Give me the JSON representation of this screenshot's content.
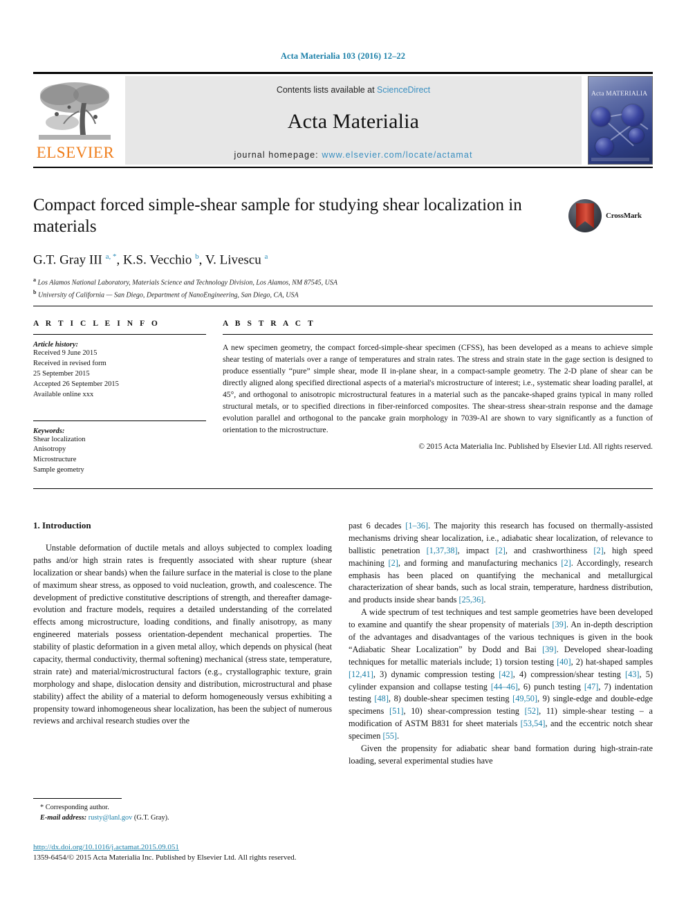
{
  "running_head": "Acta Materialia 103 (2016) 12–22",
  "masthead": {
    "contents_prefix": "Contents lists available at ",
    "sciencedirect": "ScienceDirect",
    "journal_name": "Acta Materialia",
    "homepage_prefix": "journal homepage: ",
    "homepage_url": "www.elsevier.com/locate/actamat",
    "publisher": "ELSEVIER",
    "cover_title": "Acta MATERIALIA",
    "link_color": "#3a8fc0",
    "accent_color": "#1a7fa8",
    "elsevier_orange": "#ef7d1a"
  },
  "article": {
    "title": "Compact forced simple-shear sample for studying shear localization in materials",
    "crossmark_label": "CrossMark",
    "authors_html": "G.T. Gray III <sup>a, *</sup>, K.S. Vecchio <sup>b</sup>, V. Livescu <sup>a</sup>",
    "affiliations": [
      {
        "marker": "a",
        "text": "Los Alamos National Laboratory, Materials Science and Technology Division, Los Alamos, NM 87545, USA"
      },
      {
        "marker": "b",
        "text": "University of California — San Diego, Department of NanoEngineering, San Diego, CA, USA"
      }
    ]
  },
  "article_info": {
    "label": "A R T I C L E   I N F O",
    "history_heading": "Article history:",
    "history": [
      "Received 9 June 2015",
      "Received in revised form",
      "25 September 2015",
      "Accepted 26 September 2015",
      "Available online xxx"
    ],
    "keywords_heading": "Keywords:",
    "keywords": [
      "Shear localization",
      "Anisotropy",
      "Microstructure",
      "Sample geometry"
    ]
  },
  "abstract": {
    "label": "A B S T R A C T",
    "text": "A new specimen geometry, the compact forced-simple-shear specimen (CFSS), has been developed as a means to achieve simple shear testing of materials over a range of temperatures and strain rates. The stress and strain state in the gage section is designed to produce essentially “pure” simple shear, mode II in-plane shear, in a compact-sample geometry. The 2-D plane of shear can be directly aligned along specified directional aspects of a material's microstructure of interest; i.e., systematic shear loading parallel, at 45°, and orthogonal to anisotropic microstructural features in a material such as the pancake-shaped grains typical in many rolled structural metals, or to specified directions in fiber-reinforced composites. The shear-stress shear-strain response and the damage evolution parallel and orthogonal to the pancake grain morphology in 7039-Al are shown to vary significantly as a function of orientation to the microstructure.",
    "copyright": "© 2015 Acta Materialia Inc. Published by Elsevier Ltd. All rights reserved."
  },
  "introduction": {
    "heading": "1. Introduction",
    "left_paragraph": "Unstable deformation of ductile metals and alloys subjected to complex loading paths and/or high strain rates is frequently associated with shear rupture (shear localization or shear bands) when the failure surface in the material is close to the plane of maximum shear stress, as opposed to void nucleation, growth, and coalescence. The development of predictive constitutive descriptions of strength, and thereafter damage-evolution and fracture models, requires a detailed understanding of the correlated effects among microstructure, loading conditions, and finally anisotropy, as many engineered materials possess orientation-dependent mechanical properties. The stability of plastic deformation in a given metal alloy, which depends on physical (heat capacity, thermal conductivity, thermal softening) mechanical (stress state, temperature, strain rate) and material/microstructural factors (e.g., crystallographic texture, grain morphology and shape, dislocation density and distribution, microstructural and phase stability) affect the ability of a material to deform homogeneously versus exhibiting a propensity toward inhomogeneous shear localization, has been the subject of numerous reviews and archival research studies over the",
    "right_paragraph_1_html": "past 6 decades <span class=\"ref\">[1&ndash;36]</span>. The majority this research has focused on thermally-assisted mechanisms driving shear localization, i.e., adiabatic shear localization, of relevance to ballistic penetration <span class=\"ref\">[1,37,38]</span>, impact <span class=\"ref\">[2]</span>, and crashworthiness <span class=\"ref\">[2]</span>, high speed machining <span class=\"ref\">[2]</span>, and forming and manufacturing mechanics <span class=\"ref\">[2]</span>. Accordingly, research emphasis has been placed on quantifying the mechanical and metallurgical characterization of shear bands, such as local strain, temperature, hardness distribution, and products inside shear bands <span class=\"ref\">[25,36]</span>.",
    "right_paragraph_2_html": "A wide spectrum of test techniques and test sample geometries have been developed to examine and quantify the shear propensity of materials <span class=\"ref\">[39]</span>. An in-depth description of the advantages and disadvantages of the various techniques is given in the book &ldquo;Adiabatic Shear Localization&rdquo; by Dodd and Bai <span class=\"ref\">[39]</span>. Developed shear-loading techniques for metallic materials include; 1) torsion testing <span class=\"ref\">[40]</span>, 2) hat-shaped samples <span class=\"ref\">[12,41]</span>, 3) dynamic compression testing <span class=\"ref\">[42]</span>, 4) compression/shear testing <span class=\"ref\">[43]</span>, 5) cylinder expansion and collapse testing <span class=\"ref\">[44&ndash;46]</span>, 6) punch testing <span class=\"ref\">[47]</span>, 7) indentation testing <span class=\"ref\">[48]</span>, 8) double-shear specimen testing <span class=\"ref\">[49,50]</span>, 9) single-edge and double-edge specimens <span class=\"ref\">[51]</span>, 10) shear-compression testing <span class=\"ref\">[52]</span>, 11) simple-shear testing &ndash; a modification of ASTM B831 for sheet materials <span class=\"ref\">[53,54]</span>, and the eccentric notch shear specimen <span class=\"ref\">[55]</span>.",
    "right_paragraph_3": "Given the propensity for adiabatic shear band formation during high-strain-rate loading, several experimental studies have"
  },
  "footer": {
    "corresponding_author": "* Corresponding author.",
    "email_label": "E-mail address:",
    "email": "rusty@lanl.gov",
    "email_suffix": "(G.T. Gray).",
    "doi": "http://dx.doi.org/10.1016/j.actamat.2015.09.051",
    "issn_line": "1359-6454/© 2015 Acta Materialia Inc. Published by Elsevier Ltd. All rights reserved."
  }
}
